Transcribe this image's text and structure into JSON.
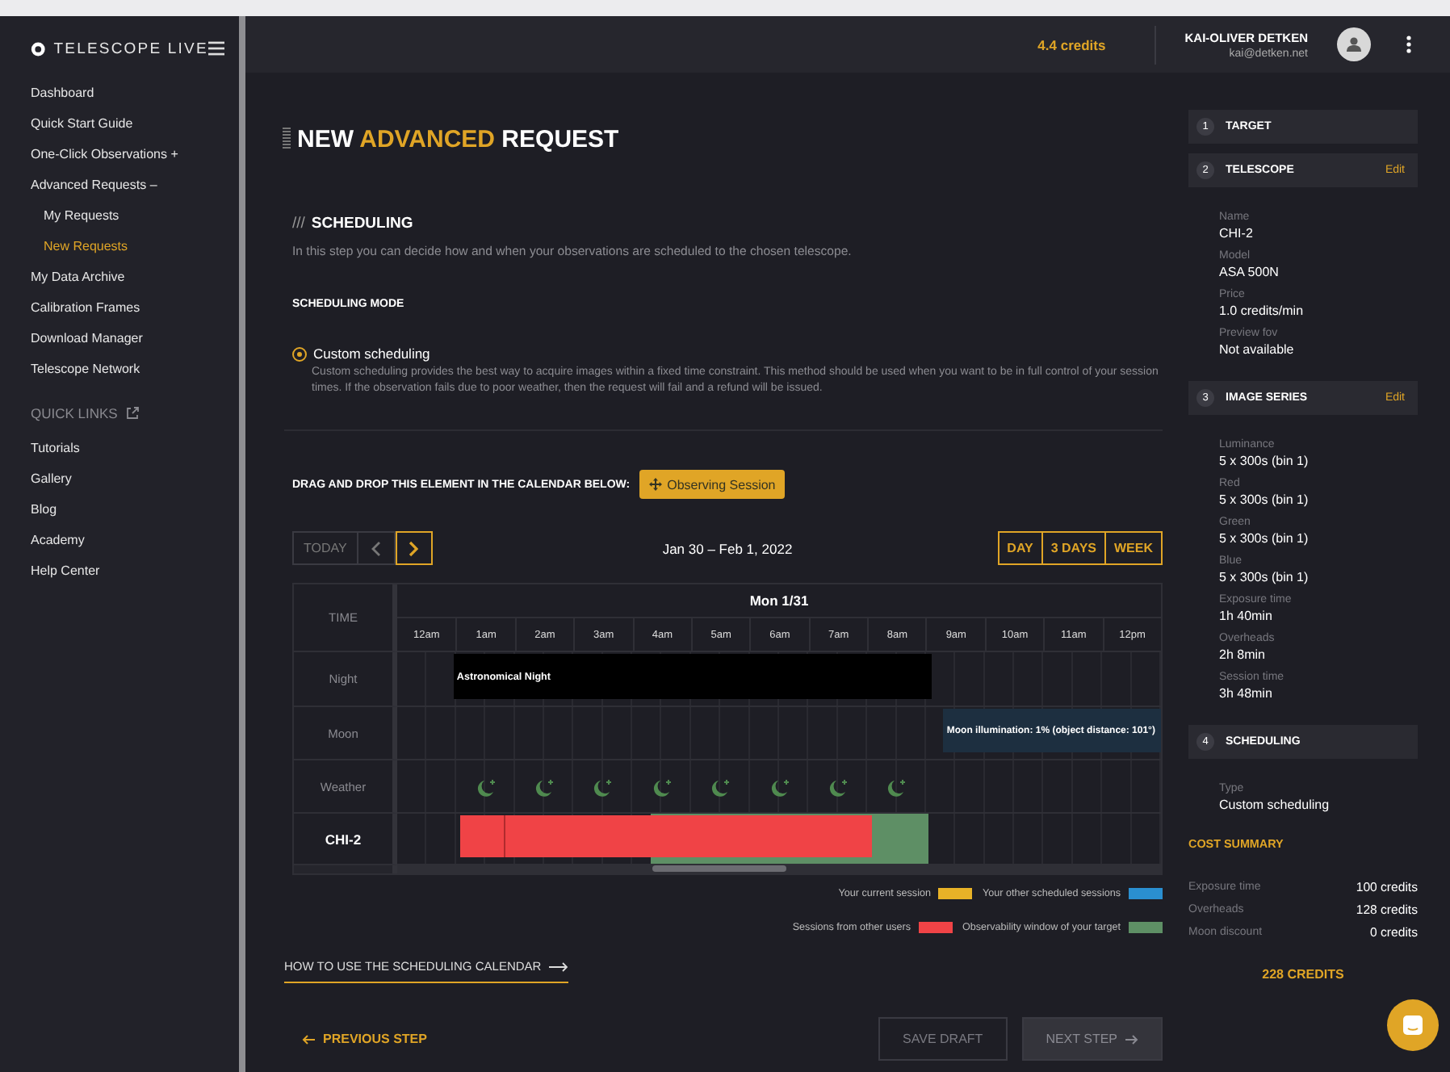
{
  "sidebar": {
    "logo": "TELESCOPE LIVE",
    "items": [
      {
        "label": "Dashboard",
        "selected": false
      },
      {
        "label": "Quick Start Guide",
        "selected": false
      },
      {
        "label": "One-Click Observations +",
        "selected": false
      },
      {
        "label": "Advanced Requests –",
        "selected": false,
        "children": [
          {
            "label": "My Requests",
            "selected": false
          },
          {
            "label": "New Requests",
            "selected": true
          }
        ]
      },
      {
        "label": "My Data Archive",
        "selected": false
      },
      {
        "label": "Calibration Frames",
        "selected": false
      },
      {
        "label": "Download Manager",
        "selected": false
      },
      {
        "label": "Telescope Network",
        "selected": false
      }
    ],
    "quick_links": {
      "title": "QUICK LINKS",
      "items": [
        "Tutorials",
        "Gallery",
        "Blog",
        "Academy",
        "Help Center"
      ]
    }
  },
  "header": {
    "credits": "4.4 credits",
    "user_name": "KAI-OLIVER DETKEN",
    "user_email": "kai@detken.net"
  },
  "page_title": [
    {
      "text": "NEW ",
      "highlight": false
    },
    {
      "text": "ADVANCED",
      "highlight": true
    },
    {
      "text": " REQUEST",
      "highlight": false
    }
  ],
  "section": {
    "prefix": "///",
    "title": "SCHEDULING",
    "description": "In this step you can decide how and when your observations are scheduled to the chosen telescope."
  },
  "scheduling_mode": {
    "label": "SCHEDULING MODE",
    "options": [
      {
        "label": "Custom scheduling",
        "selected": true,
        "description": "Custom scheduling provides the best way to acquire images within a fixed time constraint. This method should be used when you want to be in full control of your session times. If the observation fails due to poor weather, then the request will fail and a refund will be issued."
      }
    ]
  },
  "drag": {
    "label": "DRAG AND DROP THIS ELEMENT IN THE CALENDAR BELOW:",
    "button": "Observing Session"
  },
  "calendar": {
    "nav": [
      {
        "kind": "today",
        "label": "TODAY",
        "disabled": true
      },
      {
        "kind": "prev",
        "disabled": true
      },
      {
        "kind": "next",
        "disabled": false
      }
    ],
    "range": "Jan 30 – Feb 1, 2022",
    "views": [
      "DAY",
      "3 DAYS",
      "WEEK"
    ],
    "time_label": "TIME",
    "day": "Mon 1/31",
    "hours": [
      "12am",
      "1am",
      "2am",
      "3am",
      "4am",
      "5am",
      "6am",
      "7am",
      "8am",
      "9am",
      "10am",
      "11am",
      "12pm"
    ],
    "rows": [
      {
        "label": "Night",
        "kind": "night",
        "event": "Astronomical Night"
      },
      {
        "label": "Moon",
        "kind": "moon",
        "event": "Moon illumination: 1% (object distance: 101°)"
      },
      {
        "label": "Weather",
        "kind": "weather"
      },
      {
        "label": "CHI-2",
        "kind": "telescope"
      }
    ],
    "legend": [
      {
        "label": "Your current session",
        "color": "#e8b227"
      },
      {
        "label": "Your other scheduled sessions",
        "color": "#2a8fd0"
      },
      {
        "label": "Sessions from other users",
        "color": "#f04346"
      },
      {
        "label": "Observability window of your target",
        "color": "#5e8f65"
      }
    ]
  },
  "help_link": "HOW TO USE THE SCHEDULING CALENDAR",
  "footer": {
    "previous": "PREVIOUS STEP",
    "buttons": [
      {
        "label": "SAVE DRAFT",
        "kind": "outline",
        "disabled": true
      },
      {
        "label": "NEXT STEP",
        "kind": "filled",
        "disabled": true
      }
    ]
  },
  "summary": {
    "steps": [
      {
        "number": "1",
        "title": "TARGET"
      },
      {
        "number": "2",
        "title": "TELESCOPE",
        "action": "Edit",
        "fields": [
          {
            "label": "Name",
            "value": "CHI-2"
          },
          {
            "label": "Model",
            "value": "ASA 500N"
          },
          {
            "label": "Price",
            "value": "1.0 credits/min"
          },
          {
            "label": "Preview fov",
            "value": "Not available"
          }
        ]
      },
      {
        "number": "3",
        "title": "IMAGE SERIES",
        "action": "Edit",
        "fields": [
          {
            "label": "Luminance",
            "value": "5 x 300s (bin 1)"
          },
          {
            "label": "Red",
            "value": "5 x 300s (bin 1)"
          },
          {
            "label": "Green",
            "value": "5 x 300s (bin 1)"
          },
          {
            "label": "Blue",
            "value": "5 x 300s (bin 1)"
          },
          {
            "label": "Exposure time",
            "value": "1h 40min"
          },
          {
            "label": "Overheads",
            "value": "2h 8min"
          },
          {
            "label": "Session time",
            "value": "3h 48min"
          }
        ]
      },
      {
        "number": "4",
        "title": "SCHEDULING",
        "fields": [
          {
            "label": "Type",
            "value": "Custom scheduling"
          }
        ]
      }
    ],
    "cost": {
      "title": "COST SUMMARY",
      "rows": [
        {
          "label": "Exposure time",
          "value": "100 credits"
        },
        {
          "label": "Overheads",
          "value": "128 credits"
        },
        {
          "label": "Moon discount",
          "value": "0 credits"
        }
      ],
      "total": "228 CREDITS"
    }
  }
}
